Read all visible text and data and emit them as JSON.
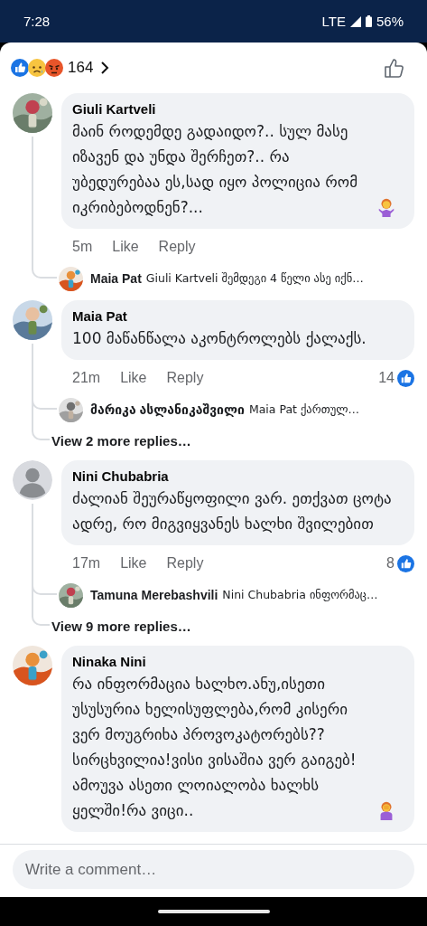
{
  "status_bar": {
    "time": "7:28",
    "network": "LTE",
    "battery": "56%"
  },
  "reactions": {
    "count": "164",
    "types": [
      {
        "kind": "like"
      },
      {
        "kind": "sad"
      },
      {
        "kind": "angry"
      }
    ]
  },
  "comments": [
    {
      "author": "Giuli Kartveli",
      "text": "მაინ  როდემდე გადაიდო?.. სულ მასე იზავენ და უნდა შერჩეთ?.. რა უბედურებაა ეს,სად იყო პოლიცია რომ იკრიბებოდნენ?...",
      "emoji": {
        "kind": "shrug"
      },
      "time": "5m",
      "like": "Like",
      "reply": "Reply",
      "replies": [
        {
          "author": "Maia Pat",
          "text": "Giuli Kartveli შემდეგი 4 წელი ასე იქნ…"
        }
      ]
    },
    {
      "author": "Maia Pat",
      "text": "100 მაწანწალა აკონტროლებს ქალაქს.",
      "time": "21m",
      "like": "Like",
      "reply": "Reply",
      "likes": "14",
      "replies": [
        {
          "author": "მარიკა ასლანიკაშვილი",
          "text": "Maia Pat ქართულ…"
        }
      ],
      "more": "View 2 more replies…"
    },
    {
      "author": "Nini Chubabria",
      "avatar": {
        "kind": "default"
      },
      "text": "ძალიან შეურაწყოფილი ვარ. ეთქვათ ცოტა ადრე, რო მიგვიყვანეს ხალხი შვილებით",
      "time": "17m",
      "like": "Like",
      "reply": "Reply",
      "likes": "8",
      "replies": [
        {
          "author": "Tamuna Merebashvili",
          "text": "Nini Chubabria ინფორმაც…"
        }
      ],
      "more": "View 9 more replies…"
    },
    {
      "author": "Ninaka Nini",
      "text": "რა ინფორმაცია ხალხო.ანუ,ისეთი უსუსურია ხელისუფლება,რომ კისერი ვერ მოუგრიხა პროვოკატორებს?? სირცხვილია!ვისი ვისაშია ვერ გაიგებ! ამოუვა ასეთი ლოიალობა ხალხს ყელში!რა ვიცი..",
      "emoji": {
        "kind": "facepalm"
      }
    }
  ],
  "composer": {
    "placeholder": "Write a comment…"
  }
}
